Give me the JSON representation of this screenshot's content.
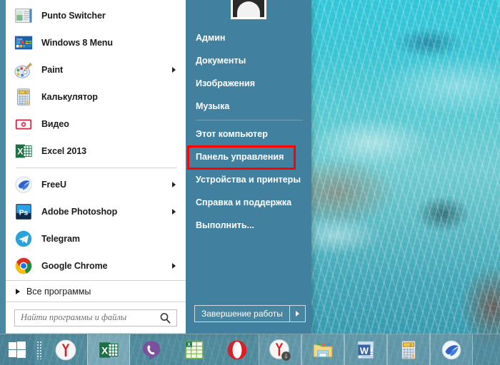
{
  "start_menu": {
    "programs": [
      {
        "label": "Punto Switcher",
        "icon": "punto-switcher-icon",
        "has_submenu": false
      },
      {
        "label": "Windows 8 Menu",
        "icon": "windows-8-menu-icon",
        "has_submenu": false
      },
      {
        "label": "Paint",
        "icon": "paint-icon",
        "has_submenu": true
      },
      {
        "label": "Калькулятор",
        "icon": "calculator-icon",
        "has_submenu": false
      },
      {
        "label": "Видео",
        "icon": "video-icon",
        "has_submenu": false
      },
      {
        "label": "Excel 2013",
        "icon": "excel-icon",
        "has_submenu": false
      },
      {
        "label": "FreeU",
        "icon": "freeu-icon",
        "has_submenu": true
      },
      {
        "label": "Adobe Photoshop",
        "icon": "photoshop-icon",
        "has_submenu": true
      },
      {
        "label": "Telegram",
        "icon": "telegram-icon",
        "has_submenu": false
      },
      {
        "label": "Google Chrome",
        "icon": "chrome-icon",
        "has_submenu": true
      }
    ],
    "all_programs_label": "Все программы",
    "search": {
      "placeholder": "Найти программы и файлы",
      "value": "",
      "icon": "search-icon"
    },
    "right_panel": {
      "avatar": "user-avatar",
      "items": [
        {
          "label": "Админ",
          "highlighted": false
        },
        {
          "label": "Документы",
          "highlighted": false
        },
        {
          "label": "Изображения",
          "highlighted": false
        },
        {
          "label": "Музыка",
          "highlighted": false
        },
        {
          "label": "Этот компьютер",
          "highlighted": false
        },
        {
          "label": "Панель управления",
          "highlighted": true
        },
        {
          "label": "Устройства и принтеры",
          "highlighted": false
        },
        {
          "label": "Справка и поддержка",
          "highlighted": false
        },
        {
          "label": "Выполнить...",
          "highlighted": false
        }
      ],
      "shutdown_label": "Завершение работы",
      "shutdown_arrow_icon": "chevron-right-icon"
    }
  },
  "taskbar": {
    "start_button_icon": "windows-start-icon",
    "grip_icon": "quick-launch-grip-icon",
    "items": [
      {
        "icon": "yandex-browser-icon",
        "state": "normal"
      },
      {
        "icon": "excel-icon",
        "state": "active"
      },
      {
        "icon": "viber-icon",
        "state": "normal"
      },
      {
        "icon": "excel-file-icon",
        "state": "normal"
      },
      {
        "icon": "opera-icon",
        "state": "normal"
      },
      {
        "icon": "yandex-disk-icon",
        "state": "open"
      },
      {
        "icon": "explorer-icon",
        "state": "open"
      },
      {
        "icon": "word-icon",
        "state": "open"
      },
      {
        "icon": "calculator-icon",
        "state": "open"
      },
      {
        "icon": "freeu-icon",
        "state": "open"
      }
    ]
  },
  "colors": {
    "right_panel_bg": "#41809e",
    "highlight_border": "#ff0000",
    "menu_border": "#4a89a6",
    "text_dark": "#1b1b1b",
    "text_light": "#ffffff"
  }
}
